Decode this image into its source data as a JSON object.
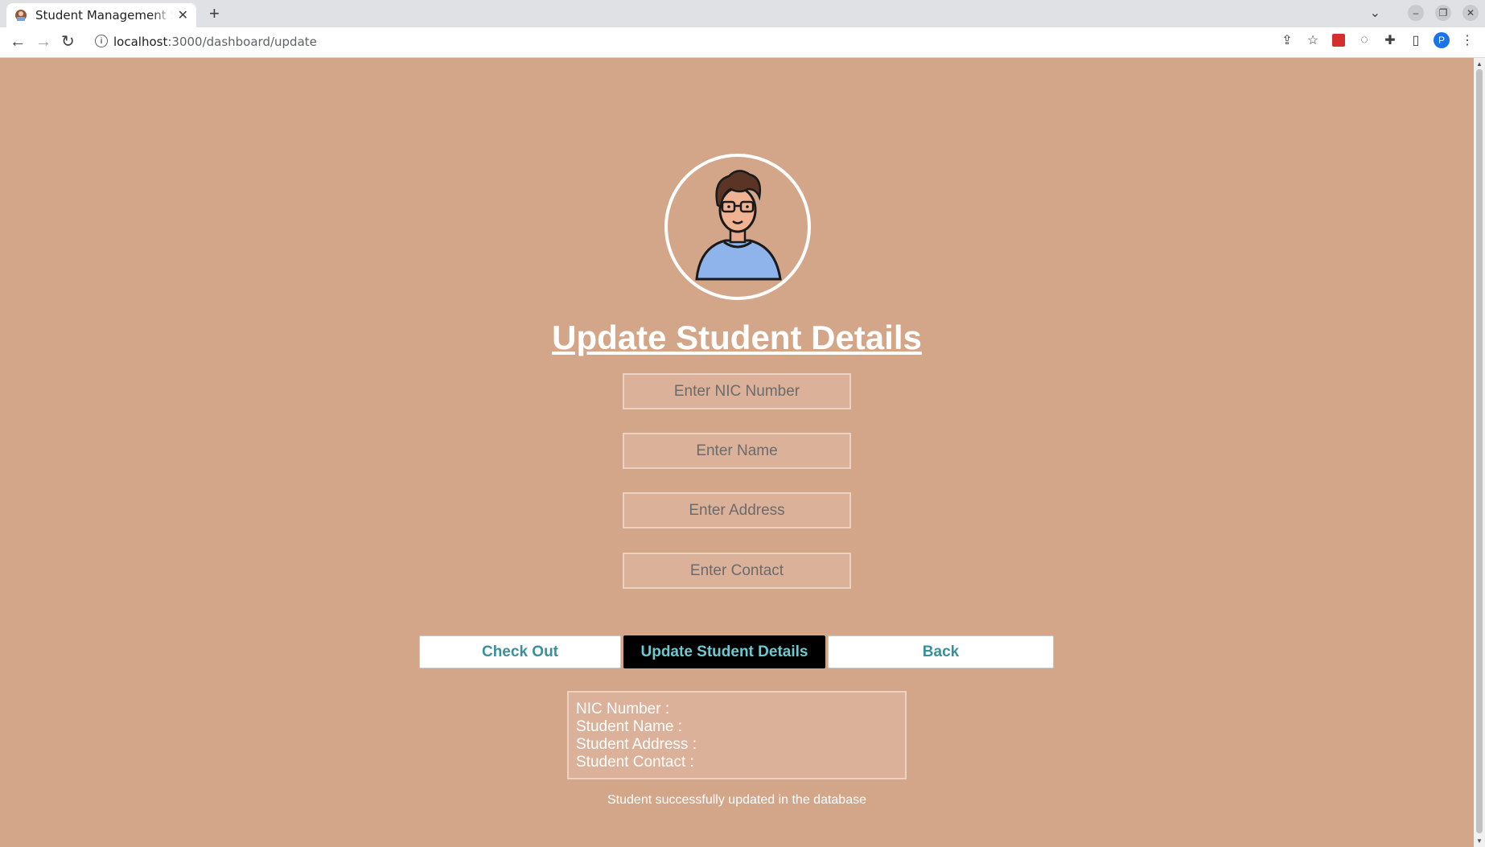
{
  "browser": {
    "tab_title": "Student Management System",
    "url_host": "localhost",
    "url_rest": ":3000/dashboard/update",
    "profile_initial": "P"
  },
  "page": {
    "title": "Update Student Details",
    "fields": {
      "nic_placeholder": "Enter NIC Number",
      "name_placeholder": "Enter Name",
      "address_placeholder": "Enter Address",
      "contact_placeholder": "Enter Contact"
    },
    "buttons": {
      "checkout": "Check Out",
      "update": "Update Student Details",
      "back": "Back"
    },
    "result": {
      "nic": "NIC Number :",
      "name": "Student Name :",
      "address": "Student Address :",
      "contact": "Student Contact :"
    },
    "message": "Student successfully updated in the database"
  },
  "colors": {
    "background": "#d3a68a",
    "button_text": "#3b8f9a",
    "dark_button": "#000000"
  }
}
